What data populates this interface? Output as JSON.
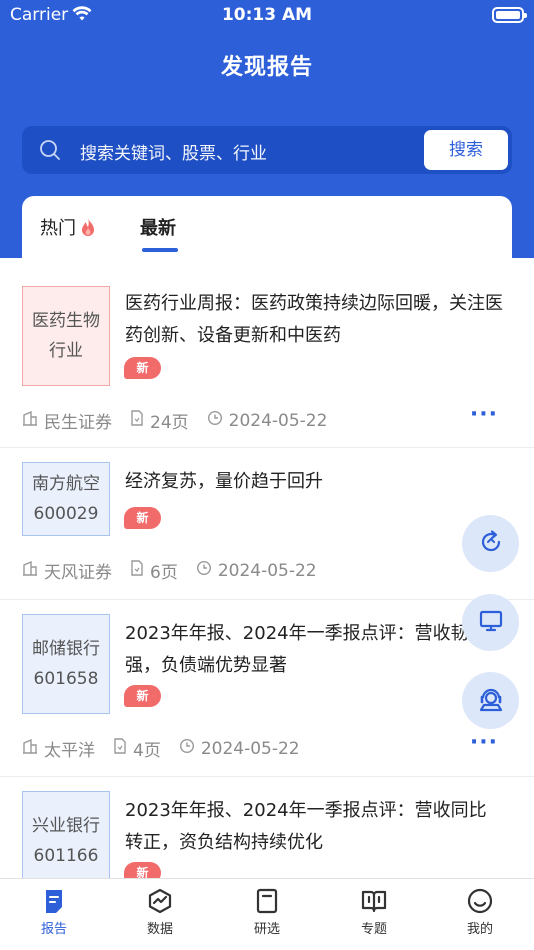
{
  "status_bar": {
    "carrier": "Carrier",
    "time": "10:13 AM"
  },
  "header": {
    "title": "发现报告"
  },
  "search": {
    "placeholder": "搜索关键词、股票、行业",
    "button_label": "搜索"
  },
  "tabs": [
    {
      "label": "热门",
      "icon": "flame-icon",
      "active": false
    },
    {
      "label": "最新",
      "active": true
    }
  ],
  "reports": [
    {
      "thumb_line1": "医药生物",
      "thumb_line2": "行业",
      "thumb_style": "red",
      "title": "医药行业周报：医药政策持续边际回暖，关注医药创新、设备更新和中医药",
      "badge": "新",
      "publisher": "民生证券",
      "pages": "24页",
      "date": "2024-05-22"
    },
    {
      "thumb_line1": "南方航空",
      "thumb_line2": "600029",
      "thumb_style": "blue",
      "title": "经济复苏，量价趋于回升",
      "badge": "新",
      "publisher": "天风证券",
      "pages": "6页",
      "date": "2024-05-22"
    },
    {
      "thumb_line1": "邮储银行",
      "thumb_line2": "601658",
      "thumb_style": "blue",
      "title": "2023年年报、2024年一季报点评：营收韧性强，负债端优势显著",
      "badge": "新",
      "publisher": "太平洋",
      "pages": "4页",
      "date": "2024-05-22"
    },
    {
      "thumb_line1": "兴业银行",
      "thumb_line2": "601166",
      "thumb_style": "blue",
      "title": "2023年年报、2024年一季报点评：营收同比转正，资负结构持续优化",
      "badge": "新"
    }
  ],
  "floating_actions": [
    "refresh-icon",
    "monitor-icon",
    "customer-service-icon"
  ],
  "tabbar": [
    {
      "label": "报告",
      "icon": "report-icon",
      "active": true
    },
    {
      "label": "数据",
      "icon": "data-icon"
    },
    {
      "label": "研选",
      "icon": "research-icon"
    },
    {
      "label": "专题",
      "icon": "topic-icon"
    },
    {
      "label": "我的",
      "icon": "profile-icon"
    }
  ],
  "colors": {
    "brand": "#2d5fd9",
    "badge": "#f26b6b"
  }
}
